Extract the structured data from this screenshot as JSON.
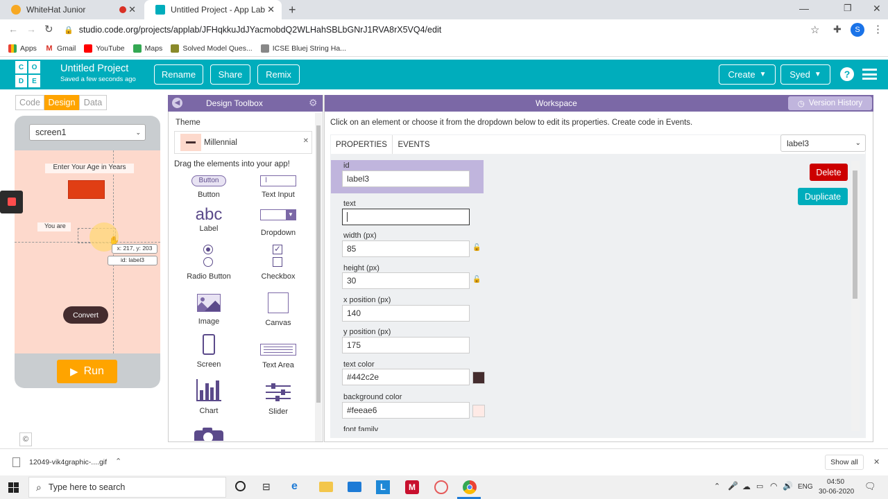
{
  "browser": {
    "tabs": [
      {
        "title": "WhiteHat Junior"
      },
      {
        "title": "Untitled Project - App Lab"
      }
    ],
    "new_tab": "+",
    "url": "studio.code.org/projects/applab/JFHqkkuJdJYacmobdQ2WLHahSBLbGNrJ1RVA8rX5VQ4/edit",
    "profile_initial": "S",
    "bookmarks": [
      "Apps",
      "Gmail",
      "YouTube",
      "Maps",
      "Solved Model Ques...",
      "ICSE Bluej String Ha..."
    ],
    "colors": {
      "tabbar": "#dee1e6",
      "profile": "#1a73e8"
    }
  },
  "header": {
    "logo_letters": [
      "C",
      "O",
      "D",
      "E"
    ],
    "project_title": "Untitled Project",
    "saved_text": "Saved a few seconds ago",
    "buttons": {
      "rename": "Rename",
      "share": "Share",
      "remix": "Remix",
      "create": "Create",
      "user": "Syed"
    },
    "colors": {
      "header_bg": "#00adbc"
    }
  },
  "left": {
    "toggles": {
      "code": "Code",
      "design": "Design",
      "data": "Data"
    },
    "screen_select": "screen1",
    "app": {
      "age_label": "Enter Your Age in Years",
      "you_are": "You are",
      "coords_tooltip": "x: 217, y: 203",
      "id_tooltip": "id: label3",
      "convert_label": "Convert"
    },
    "run_label": "Run",
    "copyright": "©",
    "colors": {
      "design_toggle": "#ffa400",
      "screen_bg": "#fdd9cc",
      "run": "#ffa400",
      "input_box": "#e03e14",
      "convert_bg": "#442c2e"
    }
  },
  "toolbox": {
    "title": "Design Toolbox",
    "theme_label": "Theme",
    "theme_value": "Millennial",
    "drag_text": "Drag the elements into your app!",
    "tools": [
      {
        "label": "Button",
        "icon": "button-icon",
        "icon_text": "Button"
      },
      {
        "label": "Text Input",
        "icon": "text-input-icon"
      },
      {
        "label": "Label",
        "icon": "label-icon",
        "icon_text": "abc"
      },
      {
        "label": "Dropdown",
        "icon": "dropdown-icon"
      },
      {
        "label": "Radio Button",
        "icon": "radio-button-icon"
      },
      {
        "label": "Checkbox",
        "icon": "checkbox-icon"
      },
      {
        "label": "Image",
        "icon": "image-icon"
      },
      {
        "label": "Canvas",
        "icon": "canvas-icon"
      },
      {
        "label": "Screen",
        "icon": "screen-icon"
      },
      {
        "label": "Text Area",
        "icon": "text-area-icon"
      },
      {
        "label": "Chart",
        "icon": "chart-icon"
      },
      {
        "label": "Slider",
        "icon": "slider-icon"
      }
    ],
    "colors": {
      "header": "#7b68a6",
      "icon": "#5b4a8a"
    }
  },
  "workspace": {
    "title": "Workspace",
    "version_history": "Version History",
    "instructions": "Click on an element or choose it from the dropdown below to edit its properties. Create code in Events.",
    "tabs": {
      "properties": "PROPERTIES",
      "events": "EVENTS"
    },
    "element_select": "label3",
    "delete_label": "Delete",
    "duplicate_label": "Duplicate",
    "properties": [
      {
        "label": "id",
        "value": "label3"
      },
      {
        "label": "text",
        "value": ""
      },
      {
        "label": "width (px)",
        "value": "85"
      },
      {
        "label": "height (px)",
        "value": "30"
      },
      {
        "label": "x position (px)",
        "value": "140"
      },
      {
        "label": "y position (px)",
        "value": "175"
      },
      {
        "label": "text color",
        "value": "#442c2e",
        "swatch": "#442c2e"
      },
      {
        "label": "background color",
        "value": "#feeae6",
        "swatch": "#feeae6"
      },
      {
        "label": "font family",
        "value": ""
      }
    ],
    "colors": {
      "delete": "#cc0000",
      "duplicate": "#00adbc",
      "id_highlight": "#c0b5dd"
    }
  },
  "downloads": {
    "file": "12049-vik4graphic-....gif",
    "show_all": "Show all"
  },
  "taskbar": {
    "search_placeholder": "Type here to search",
    "lang": "ENG",
    "time": "04:50",
    "date": "30-06-2020"
  }
}
